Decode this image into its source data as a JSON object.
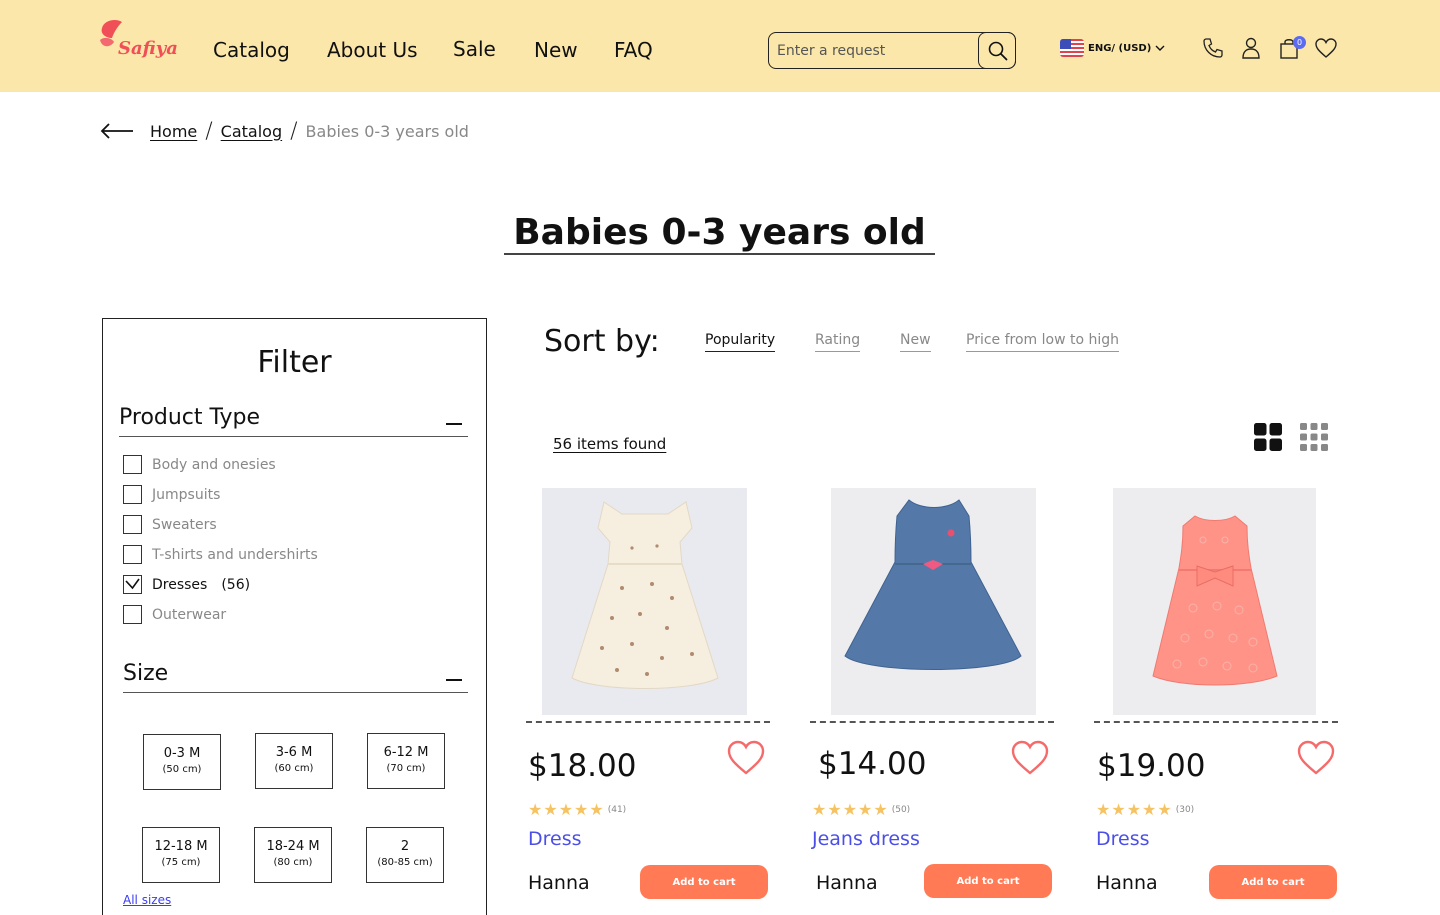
{
  "header": {
    "brand": "Safiya",
    "nav": [
      "Catalog",
      "About Us",
      "Sale",
      "New",
      "FAQ"
    ],
    "search_placeholder": "Enter a request",
    "language": "ENG/ (USD)",
    "cart_count": "0",
    "colors": {
      "header_bg": "#FCE7AA",
      "logo": "#F04F57",
      "badge": "#5B6BF2"
    },
    "icons": [
      "search-icon",
      "flag-us-icon",
      "chevron-down-icon",
      "phone-icon",
      "user-icon",
      "shopping-bag-icon",
      "heart-icon"
    ]
  },
  "breadcrumb": {
    "items": [
      "Home",
      "Catalog"
    ],
    "current": "Babies 0-3 years old"
  },
  "page_title": "Babies 0-3 years old",
  "filter": {
    "title": "Filter",
    "product_type": {
      "heading": "Product Type",
      "options": [
        {
          "label": "Body and onesies",
          "checked": false
        },
        {
          "label": "Jumpsuits",
          "checked": false
        },
        {
          "label": "Sweaters",
          "checked": false
        },
        {
          "label": "T-shirts and undershirts",
          "checked": false
        },
        {
          "label": "Dresses",
          "checked": true,
          "count": "(56)"
        },
        {
          "label": "Outerwear",
          "checked": false
        }
      ]
    },
    "size": {
      "heading": "Size",
      "options": [
        {
          "label": "0-3 M",
          "sub": "(50 cm)"
        },
        {
          "label": "3-6 M",
          "sub": "(60 cm)"
        },
        {
          "label": "6-12 M",
          "sub": "(70 cm)"
        },
        {
          "label": "12-18 M",
          "sub": "(75 cm)"
        },
        {
          "label": "18-24 M",
          "sub": "(80 cm)"
        },
        {
          "label": "2",
          "sub": "(80-85 cm)"
        }
      ],
      "all_sizes": "All sizes"
    }
  },
  "sort": {
    "label": "Sort by:",
    "options": [
      "Popularity",
      "Rating",
      "New",
      "Price from low to high"
    ],
    "active": "Popularity"
  },
  "results": {
    "items_found": "56 items found"
  },
  "products": [
    {
      "price": "$18.00",
      "rating_count": "(41)",
      "rating": 5,
      "name": "Dress",
      "brand": "Hanna",
      "cta": "Add to cart"
    },
    {
      "price": "$14.00",
      "rating_count": "(50)",
      "rating": 5,
      "name": "Jeans dress",
      "brand": "Hanna",
      "cta": "Add to cart"
    },
    {
      "price": "$19.00",
      "rating_count": "(30)",
      "rating": 5,
      "name": "Dress",
      "brand": "Hanna",
      "cta": "Add to cart"
    }
  ],
  "accent_colors": {
    "button": "#FF7A55",
    "product_name": "#4B4FE8",
    "star": "#F6C363",
    "heart": "#F56B6B"
  }
}
